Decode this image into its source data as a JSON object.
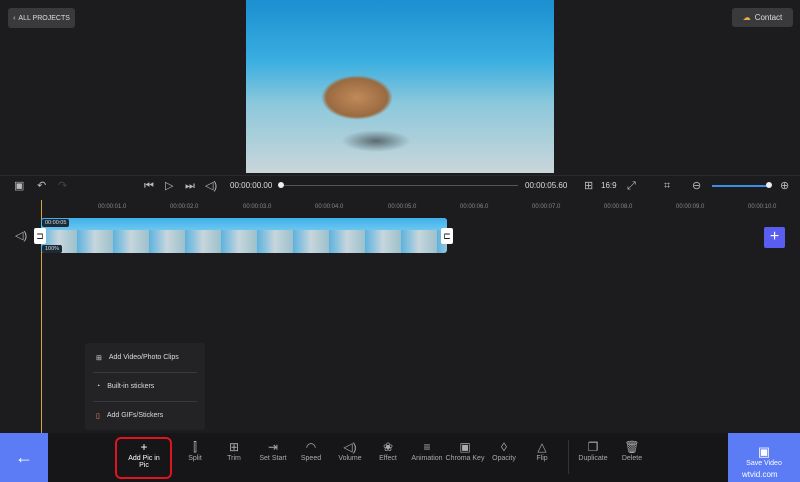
{
  "header": {
    "all_projects": "ALL PROJECTS",
    "contact": "Contact"
  },
  "player": {
    "current_time": "00:00:00.00",
    "total_time": "00:00:05.60",
    "aspect_ratio": "16:9",
    "progress": 0
  },
  "zoom_level": 1.0,
  "ruler": [
    "00:00:01.0",
    "00:00:02.0",
    "00:00:03.0",
    "00:00:04.0",
    "00:00:05.0",
    "00:00:06.0",
    "00:00:07.0",
    "00:00:08.0",
    "00:00:09.0",
    "00:00:10.0"
  ],
  "clip": {
    "duration": "00:00:05",
    "volume": "100%"
  },
  "menu": [
    {
      "label": "Add Video/Photo Clips",
      "icon": "add-file-icon"
    },
    {
      "label": "Built-in stickers",
      "icon": "sticker-icon"
    },
    {
      "label": "Add GIFs/Stickers",
      "icon": "gif-icon"
    }
  ],
  "tools": [
    {
      "label": "Add Pic in Pic",
      "icon": "plus-icon",
      "g": "+"
    },
    {
      "label": "Split",
      "icon": "split-icon",
      "g": "⫿"
    },
    {
      "label": "Trim",
      "icon": "trim-icon",
      "g": "⊞"
    },
    {
      "label": "Set Start",
      "icon": "set-start-icon",
      "g": "⇥"
    },
    {
      "label": "Speed",
      "icon": "speed-icon",
      "g": "◠"
    },
    {
      "label": "Volume",
      "icon": "volume-icon",
      "g": "◁)"
    },
    {
      "label": "Effect",
      "icon": "effect-icon",
      "g": "❀"
    },
    {
      "label": "Animation",
      "icon": "animation-icon",
      "g": "≡"
    },
    {
      "label": "Chroma Key",
      "icon": "chroma-key-icon",
      "g": "▣"
    },
    {
      "label": "Opacity",
      "icon": "opacity-icon",
      "g": "◊"
    },
    {
      "label": "Flip",
      "icon": "flip-icon",
      "g": "△"
    },
    {
      "label": "Duplicate",
      "icon": "duplicate-icon",
      "g": "❐"
    },
    {
      "label": "Delete",
      "icon": "trash-icon",
      "g": "🗑"
    }
  ],
  "save_video": "Save Video",
  "watermark": "wtvid.com",
  "colors": {
    "accent": "#5b7cf5",
    "highlight": "#e0141e",
    "playhead": "#d4a340"
  }
}
